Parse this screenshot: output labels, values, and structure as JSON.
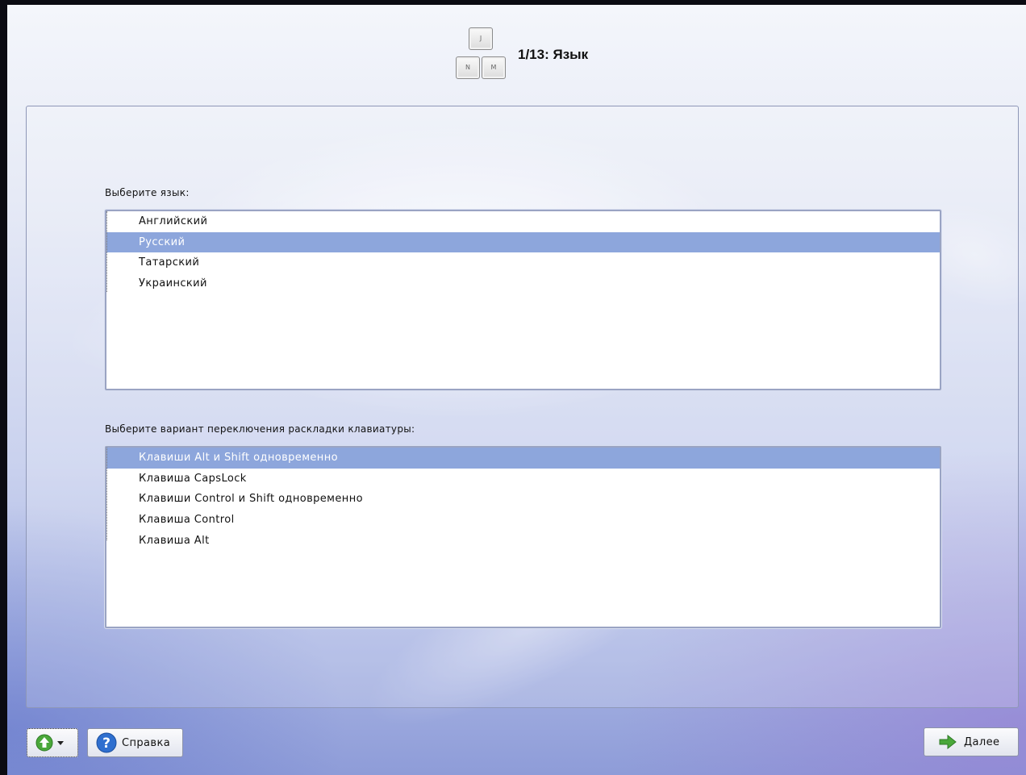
{
  "header": {
    "step_title": "1/13: Язык",
    "keys": [
      "J",
      "N",
      "M"
    ]
  },
  "language": {
    "label": "Выберите язык:",
    "items": [
      "Английский",
      "Русский",
      "Татарский",
      "Украинский"
    ],
    "selected": "Русский"
  },
  "layout_switch": {
    "label": "Выберите вариант переключения раскладки клавиатуры:",
    "items": [
      "Клавиши Alt и Shift одновременно",
      "Клавиша CapsLock",
      "Клавиши Control и Shift одновременно",
      "Клавиша Control",
      "Клавиша Alt"
    ],
    "selected": "Клавиши Alt и Shift одновременно"
  },
  "footer": {
    "up_button_icon": "up-arrow-icon",
    "help_label": "Справка",
    "next_label": "Далее"
  },
  "colors": {
    "selection": "#8da6dc",
    "panel_border": "#8e97b7",
    "help_icon": "#2f6fcf",
    "next_arrow": "#4aa83a"
  }
}
